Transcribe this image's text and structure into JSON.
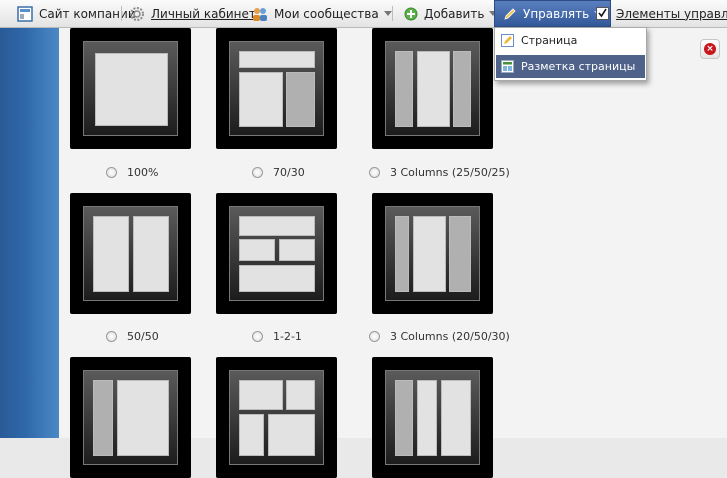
{
  "toolbar": {
    "site": "Сайт компании",
    "cabinet": "Личный кабинет",
    "communities": "Мои сообщества",
    "add": "Добавить",
    "manage": "Управлять",
    "elements": "Элементы управлени"
  },
  "menu": {
    "items": [
      "Страница",
      "Разметка страницы"
    ],
    "active": "Разметка страницы"
  },
  "layouts": [
    "100%",
    "70/30",
    "3 Columns (25/50/25)",
    "50/50",
    "1-2-1",
    "3 Columns (20/50/30)"
  ]
}
